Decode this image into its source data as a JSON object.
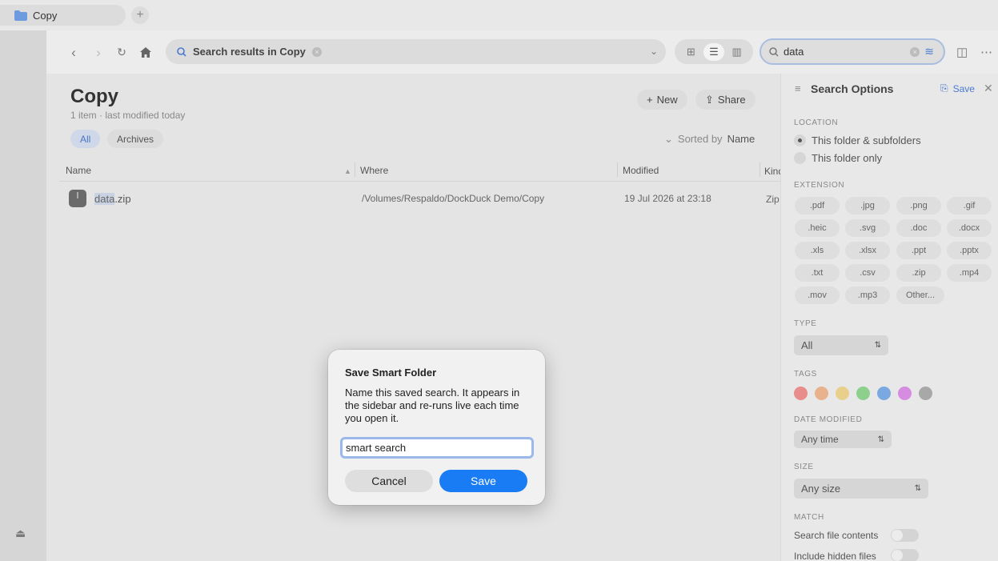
{
  "tab": {
    "title": "Copy",
    "add_label": "+"
  },
  "toolbar": {
    "path_text": "Search results in Copy",
    "search_value": "data"
  },
  "folder": {
    "title": "Copy",
    "subtitle": "1 item · last modified today",
    "filters": [
      "All",
      "Archives"
    ],
    "new_label": "New",
    "share_label": "Share",
    "sorted_prefix": "Sorted by",
    "sorted_field": "Name"
  },
  "table": {
    "columns": [
      "Name",
      "Where",
      "Modified",
      "Kind"
    ],
    "rows": [
      {
        "name_match": "data",
        "name_rest": ".zip",
        "where": "/Volumes/Respaldo/DockDuck Demo/Copy",
        "modified": "19 Jul 2026 at 23:18",
        "kind": "Zip"
      }
    ]
  },
  "panel": {
    "title": "Search Options",
    "save_label": "Save",
    "location_label": "LOCATION",
    "location_options": [
      "This folder & subfolders",
      "This folder only"
    ],
    "extension_label": "EXTENSION",
    "extensions": [
      ".pdf",
      ".jpg",
      ".png",
      ".gif",
      ".heic",
      ".svg",
      ".doc",
      ".docx",
      ".xls",
      ".xlsx",
      ".ppt",
      ".pptx",
      ".txt",
      ".csv",
      ".zip",
      ".mp4",
      ".mov",
      ".mp3",
      "Other..."
    ],
    "type_label": "TYPE",
    "type_value": "All",
    "tags_label": "TAGS",
    "tag_colors": [
      "#e88c8c",
      "#e8b38c",
      "#e8d08c",
      "#8cd08c",
      "#7aa8e0",
      "#d68ce0",
      "#a8a8a8"
    ],
    "date_label": "DATE MODIFIED",
    "date_value": "Any time",
    "size_label": "SIZE",
    "size_value": "Any size",
    "match_label": "MATCH",
    "match_options": [
      "Search file contents",
      "Include hidden files"
    ]
  },
  "dialog": {
    "title": "Save Smart Folder",
    "message": "Name this saved search. It appears in the sidebar and re-runs live each time you open it.",
    "input_value": "smart search",
    "cancel_label": "Cancel",
    "save_label": "Save"
  }
}
